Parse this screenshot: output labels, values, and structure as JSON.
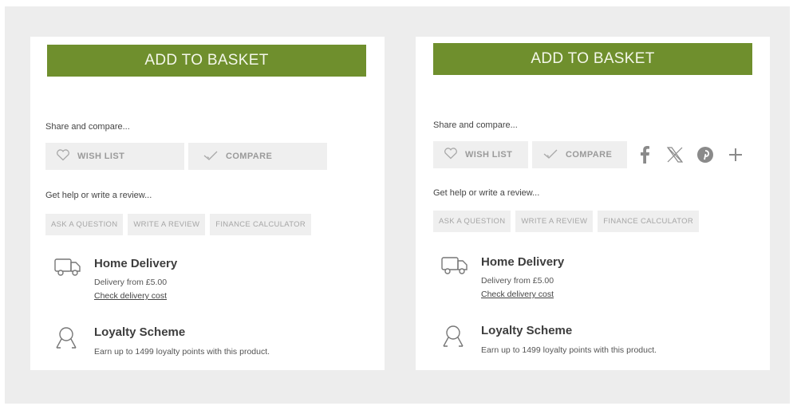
{
  "panels": [
    {
      "add_to_basket": "ADD TO BASKET",
      "share_label": "Share and compare...",
      "wish_list": "WISH LIST",
      "compare": "COMPARE",
      "help_label": "Get help or write a review...",
      "help_buttons": [
        "ASK A QUESTION",
        "WRITE A REVIEW",
        "FINANCE CALCULATOR"
      ],
      "delivery": {
        "title": "Home Delivery",
        "from": "Delivery from £5.00",
        "check": "Check delivery cost"
      },
      "loyalty": {
        "title": "Loyalty Scheme",
        "text": "Earn up to 1499 loyalty points with this product."
      }
    },
    {
      "add_to_basket": "ADD TO BASKET",
      "share_label": "Share and compare...",
      "wish_list": "WISH LIST",
      "compare": "COMPARE",
      "social_icons": [
        "facebook-icon",
        "x-icon",
        "pinterest-icon",
        "plus-icon"
      ],
      "help_label": "Get help or write a review...",
      "help_buttons": [
        "ASK A QUESTION",
        "WRITE A REVIEW",
        "FINANCE CALCULATOR"
      ],
      "delivery": {
        "title": "Home Delivery",
        "from": "Delivery from £5.00",
        "check": "Check delivery cost"
      },
      "loyalty": {
        "title": "Loyalty Scheme",
        "text": "Earn up to 1499 loyalty points with this product."
      }
    }
  ],
  "colors": {
    "accent": "#6f8f2d",
    "backdrop": "#ededed",
    "button_bg": "#efefef"
  }
}
